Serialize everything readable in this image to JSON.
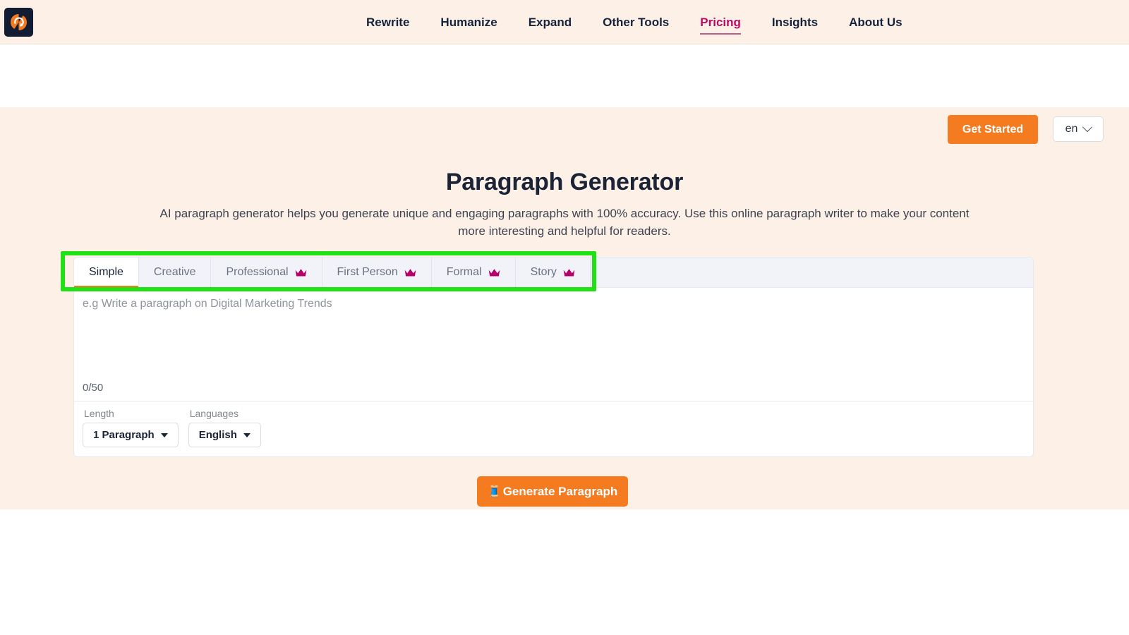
{
  "header": {
    "logo_icon": "rewrite-circular-arrow-logo",
    "nav_items": [
      {
        "label": "Rewrite",
        "active": false
      },
      {
        "label": "Humanize",
        "active": false
      },
      {
        "label": "Expand",
        "active": false
      },
      {
        "label": "Other Tools",
        "active": false
      },
      {
        "label": "Pricing",
        "active": true
      },
      {
        "label": "Insights",
        "active": false
      },
      {
        "label": "About Us",
        "active": false
      }
    ],
    "get_started_label": "Get Started",
    "language": "en",
    "language_chevron_icon": "chevron-down-icon"
  },
  "hero": {
    "title": "Paragraph Generator",
    "subtitle": "AI paragraph generator helps you generate unique and engaging paragraphs with 100% accuracy. Use this online paragraph writer to make your content more interesting and helpful for readers."
  },
  "tool": {
    "tabs": [
      {
        "label": "Simple",
        "active": true,
        "premium": false
      },
      {
        "label": "Creative",
        "active": false,
        "premium": false
      },
      {
        "label": "Professional",
        "active": false,
        "premium": true
      },
      {
        "label": "First Person",
        "active": false,
        "premium": true
      },
      {
        "label": "Formal",
        "active": false,
        "premium": true
      },
      {
        "label": "Story",
        "active": false,
        "premium": true
      }
    ],
    "premium_icon": "crown-icon",
    "editor_placeholder": "e.g Write a paragraph on Digital Marketing Trends",
    "editor_value": "",
    "counter": "0/50",
    "controls": [
      {
        "label": "Length",
        "value": "1 Paragraph",
        "icon": "caret-down-icon"
      },
      {
        "label": "Languages",
        "value": "English",
        "icon": "caret-down-icon"
      }
    ],
    "generate_label": "Generate Paragraph",
    "generate_icon": "magic-wand-icon"
  },
  "annotation": {
    "highlight_target": "style-tabs-row",
    "color": "#22e016"
  },
  "colors": {
    "page_background": "#ffffff",
    "hero_background": "#fdf0e7",
    "accent_orange": "#f47b20",
    "accent_pink": "#bb0a64",
    "crown_magenta": "#b5006b",
    "dark_navy": "#1b2336",
    "tab_inactive_bg": "#f2f3f8"
  }
}
